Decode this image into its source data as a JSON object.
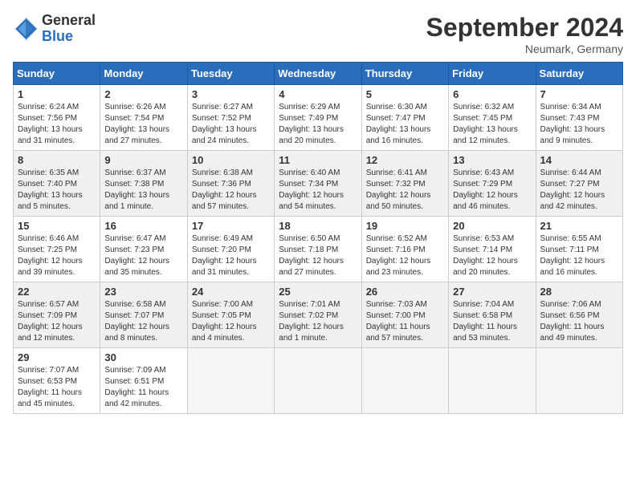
{
  "header": {
    "logo_general": "General",
    "logo_blue": "Blue",
    "month_title": "September 2024",
    "location": "Neumark, Germany"
  },
  "days_of_week": [
    "Sunday",
    "Monday",
    "Tuesday",
    "Wednesday",
    "Thursday",
    "Friday",
    "Saturday"
  ],
  "weeks": [
    {
      "shaded": false,
      "days": [
        {
          "num": "1",
          "sunrise": "Sunrise: 6:24 AM",
          "sunset": "Sunset: 7:56 PM",
          "daylight": "Daylight: 13 hours and 31 minutes."
        },
        {
          "num": "2",
          "sunrise": "Sunrise: 6:26 AM",
          "sunset": "Sunset: 7:54 PM",
          "daylight": "Daylight: 13 hours and 27 minutes."
        },
        {
          "num": "3",
          "sunrise": "Sunrise: 6:27 AM",
          "sunset": "Sunset: 7:52 PM",
          "daylight": "Daylight: 13 hours and 24 minutes."
        },
        {
          "num": "4",
          "sunrise": "Sunrise: 6:29 AM",
          "sunset": "Sunset: 7:49 PM",
          "daylight": "Daylight: 13 hours and 20 minutes."
        },
        {
          "num": "5",
          "sunrise": "Sunrise: 6:30 AM",
          "sunset": "Sunset: 7:47 PM",
          "daylight": "Daylight: 13 hours and 16 minutes."
        },
        {
          "num": "6",
          "sunrise": "Sunrise: 6:32 AM",
          "sunset": "Sunset: 7:45 PM",
          "daylight": "Daylight: 13 hours and 12 minutes."
        },
        {
          "num": "7",
          "sunrise": "Sunrise: 6:34 AM",
          "sunset": "Sunset: 7:43 PM",
          "daylight": "Daylight: 13 hours and 9 minutes."
        }
      ]
    },
    {
      "shaded": true,
      "days": [
        {
          "num": "8",
          "sunrise": "Sunrise: 6:35 AM",
          "sunset": "Sunset: 7:40 PM",
          "daylight": "Daylight: 13 hours and 5 minutes."
        },
        {
          "num": "9",
          "sunrise": "Sunrise: 6:37 AM",
          "sunset": "Sunset: 7:38 PM",
          "daylight": "Daylight: 13 hours and 1 minute."
        },
        {
          "num": "10",
          "sunrise": "Sunrise: 6:38 AM",
          "sunset": "Sunset: 7:36 PM",
          "daylight": "Daylight: 12 hours and 57 minutes."
        },
        {
          "num": "11",
          "sunrise": "Sunrise: 6:40 AM",
          "sunset": "Sunset: 7:34 PM",
          "daylight": "Daylight: 12 hours and 54 minutes."
        },
        {
          "num": "12",
          "sunrise": "Sunrise: 6:41 AM",
          "sunset": "Sunset: 7:32 PM",
          "daylight": "Daylight: 12 hours and 50 minutes."
        },
        {
          "num": "13",
          "sunrise": "Sunrise: 6:43 AM",
          "sunset": "Sunset: 7:29 PM",
          "daylight": "Daylight: 12 hours and 46 minutes."
        },
        {
          "num": "14",
          "sunrise": "Sunrise: 6:44 AM",
          "sunset": "Sunset: 7:27 PM",
          "daylight": "Daylight: 12 hours and 42 minutes."
        }
      ]
    },
    {
      "shaded": false,
      "days": [
        {
          "num": "15",
          "sunrise": "Sunrise: 6:46 AM",
          "sunset": "Sunset: 7:25 PM",
          "daylight": "Daylight: 12 hours and 39 minutes."
        },
        {
          "num": "16",
          "sunrise": "Sunrise: 6:47 AM",
          "sunset": "Sunset: 7:23 PM",
          "daylight": "Daylight: 12 hours and 35 minutes."
        },
        {
          "num": "17",
          "sunrise": "Sunrise: 6:49 AM",
          "sunset": "Sunset: 7:20 PM",
          "daylight": "Daylight: 12 hours and 31 minutes."
        },
        {
          "num": "18",
          "sunrise": "Sunrise: 6:50 AM",
          "sunset": "Sunset: 7:18 PM",
          "daylight": "Daylight: 12 hours and 27 minutes."
        },
        {
          "num": "19",
          "sunrise": "Sunrise: 6:52 AM",
          "sunset": "Sunset: 7:16 PM",
          "daylight": "Daylight: 12 hours and 23 minutes."
        },
        {
          "num": "20",
          "sunrise": "Sunrise: 6:53 AM",
          "sunset": "Sunset: 7:14 PM",
          "daylight": "Daylight: 12 hours and 20 minutes."
        },
        {
          "num": "21",
          "sunrise": "Sunrise: 6:55 AM",
          "sunset": "Sunset: 7:11 PM",
          "daylight": "Daylight: 12 hours and 16 minutes."
        }
      ]
    },
    {
      "shaded": true,
      "days": [
        {
          "num": "22",
          "sunrise": "Sunrise: 6:57 AM",
          "sunset": "Sunset: 7:09 PM",
          "daylight": "Daylight: 12 hours and 12 minutes."
        },
        {
          "num": "23",
          "sunrise": "Sunrise: 6:58 AM",
          "sunset": "Sunset: 7:07 PM",
          "daylight": "Daylight: 12 hours and 8 minutes."
        },
        {
          "num": "24",
          "sunrise": "Sunrise: 7:00 AM",
          "sunset": "Sunset: 7:05 PM",
          "daylight": "Daylight: 12 hours and 4 minutes."
        },
        {
          "num": "25",
          "sunrise": "Sunrise: 7:01 AM",
          "sunset": "Sunset: 7:02 PM",
          "daylight": "Daylight: 12 hours and 1 minute."
        },
        {
          "num": "26",
          "sunrise": "Sunrise: 7:03 AM",
          "sunset": "Sunset: 7:00 PM",
          "daylight": "Daylight: 11 hours and 57 minutes."
        },
        {
          "num": "27",
          "sunrise": "Sunrise: 7:04 AM",
          "sunset": "Sunset: 6:58 PM",
          "daylight": "Daylight: 11 hours and 53 minutes."
        },
        {
          "num": "28",
          "sunrise": "Sunrise: 7:06 AM",
          "sunset": "Sunset: 6:56 PM",
          "daylight": "Daylight: 11 hours and 49 minutes."
        }
      ]
    },
    {
      "shaded": false,
      "days": [
        {
          "num": "29",
          "sunrise": "Sunrise: 7:07 AM",
          "sunset": "Sunset: 6:53 PM",
          "daylight": "Daylight: 11 hours and 45 minutes."
        },
        {
          "num": "30",
          "sunrise": "Sunrise: 7:09 AM",
          "sunset": "Sunset: 6:51 PM",
          "daylight": "Daylight: 11 hours and 42 minutes."
        },
        {
          "num": "",
          "sunrise": "",
          "sunset": "",
          "daylight": ""
        },
        {
          "num": "",
          "sunrise": "",
          "sunset": "",
          "daylight": ""
        },
        {
          "num": "",
          "sunrise": "",
          "sunset": "",
          "daylight": ""
        },
        {
          "num": "",
          "sunrise": "",
          "sunset": "",
          "daylight": ""
        },
        {
          "num": "",
          "sunrise": "",
          "sunset": "",
          "daylight": ""
        }
      ]
    }
  ]
}
